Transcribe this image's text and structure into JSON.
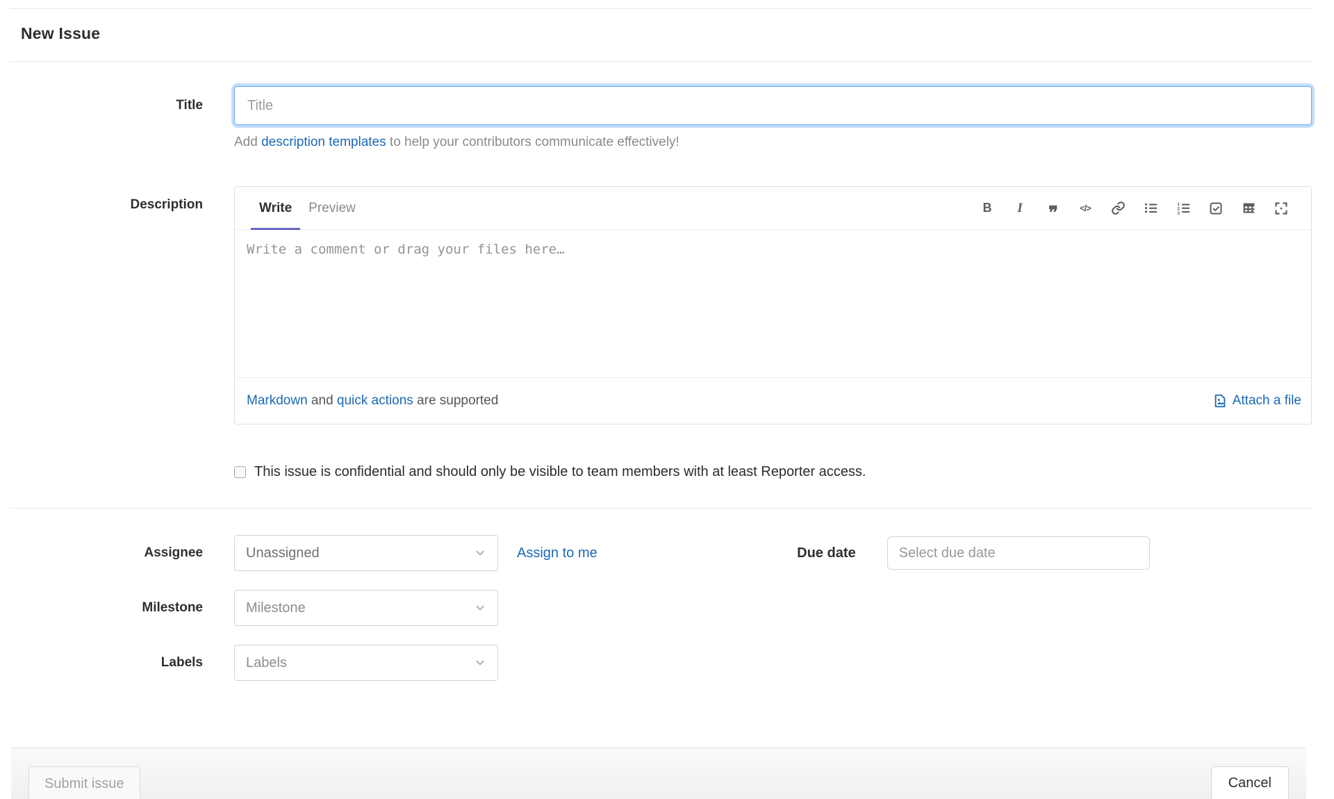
{
  "page": {
    "title": "New Issue"
  },
  "title_field": {
    "label": "Title",
    "placeholder": "Title",
    "value": "",
    "help_prefix": "Add ",
    "help_link": "description templates",
    "help_suffix": " to help your contributors communicate effectively!"
  },
  "description_field": {
    "label": "Description",
    "tabs": [
      {
        "label": "Write",
        "active": true
      },
      {
        "label": "Preview",
        "active": false
      }
    ],
    "toolbar_icons": [
      "bold-icon",
      "italic-icon",
      "quote-icon",
      "code-icon",
      "link-icon",
      "bullet-list-icon",
      "numbered-list-icon",
      "task-list-icon",
      "table-icon",
      "fullscreen-icon"
    ],
    "toolbar_glyphs": {
      "bold": "B",
      "italic": "I",
      "quote": "””",
      "code": "</>"
    },
    "placeholder": "Write a comment or drag your files here…",
    "value": "",
    "footer_markdown_link": "Markdown",
    "footer_middle": " and ",
    "footer_quick_actions_link": "quick actions",
    "footer_suffix": " are supported",
    "attach_label": "Attach a file"
  },
  "confidential": {
    "checked": false,
    "label": "This issue is confidential and should only be visible to team members with at least Reporter access."
  },
  "assignee": {
    "label": "Assignee",
    "value": "Unassigned",
    "assign_to_me_label": "Assign to me"
  },
  "due_date": {
    "label": "Due date",
    "placeholder": "Select due date",
    "value": ""
  },
  "milestone": {
    "label": "Milestone",
    "value": "Milestone"
  },
  "labels": {
    "label": "Labels",
    "value": "Labels"
  },
  "actions": {
    "submit_label": "Submit issue",
    "cancel_label": "Cancel"
  },
  "colors": {
    "link_blue": "#1b69b6",
    "active_tab_underline": "#6666c4",
    "focused_input_border": "#67a8ec",
    "muted_text": "#8a8a8a",
    "border": "#dfdfdf",
    "footer_background": "#f5f5f5"
  }
}
